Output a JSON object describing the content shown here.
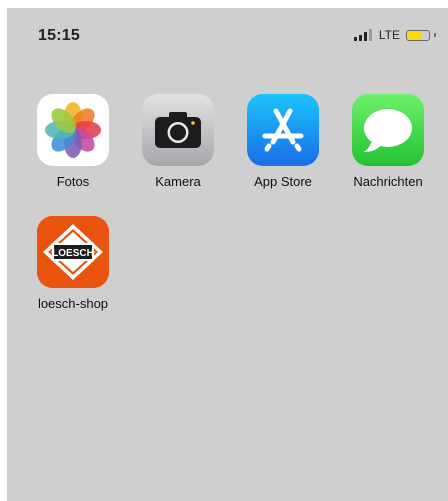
{
  "status_bar": {
    "time": "15:15",
    "network": "LTE",
    "battery_level": 0.62,
    "battery_color": "#ffd60a",
    "signal_bars_active": 3
  },
  "apps": [
    {
      "label": "Fotos",
      "icon": "photos-icon"
    },
    {
      "label": "Kamera",
      "icon": "camera-icon"
    },
    {
      "label": "App Store",
      "icon": "app-store-icon"
    },
    {
      "label": "Nachrichten",
      "icon": "messages-icon"
    },
    {
      "label": "loesch-shop",
      "icon": "loesch-logo-icon",
      "logo_text": "LOESCH"
    }
  ],
  "colors": {
    "wallpaper": "#cfcfcf",
    "loesch_orange": "#e8540e"
  }
}
